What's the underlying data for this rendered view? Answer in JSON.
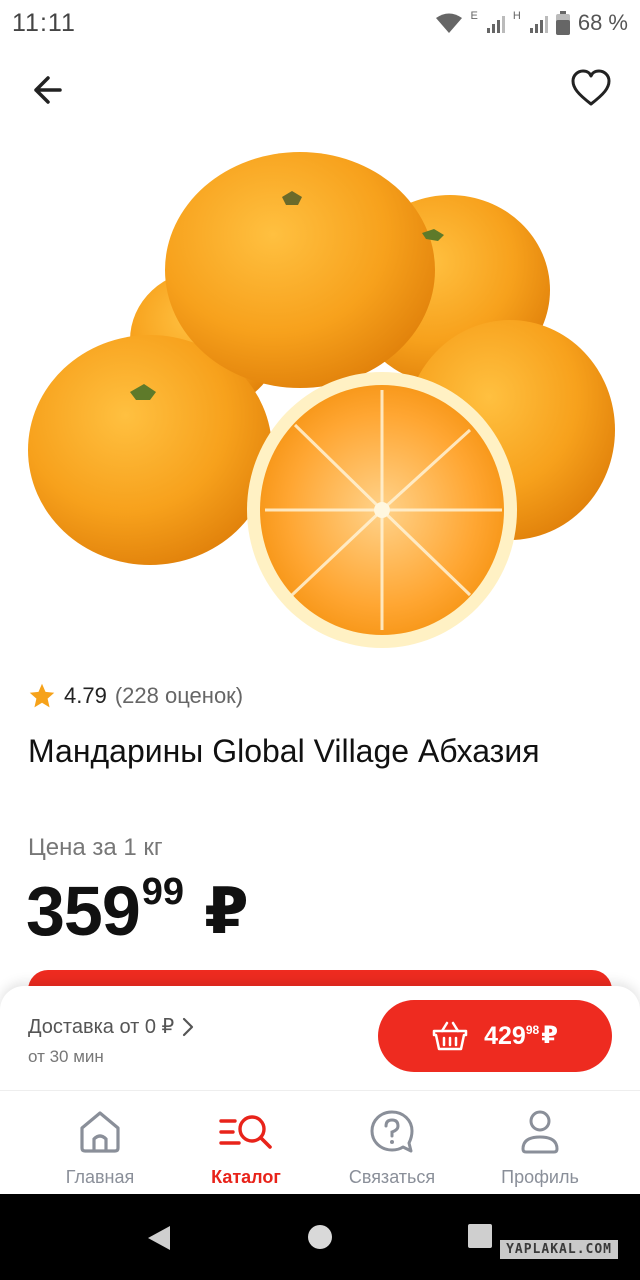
{
  "status_bar": {
    "time": "11:11",
    "network_1": "E",
    "network_2": "H",
    "battery": "68 %"
  },
  "top_nav": {
    "back_icon": "arrow-left-icon",
    "favorite_icon": "heart-outline-icon"
  },
  "product": {
    "image": "mandarins-photo",
    "rating_icon": "star-icon",
    "rating_value": "4.79",
    "rating_count": "(228 оценок)",
    "title": "Мандарины Global Village Абхазия",
    "price_caption": "Цена за 1 кг",
    "price_integer": "359",
    "price_fraction": "99",
    "price_currency": "₽"
  },
  "delivery_bar": {
    "delivery_text": "Доставка от 0 ₽",
    "delivery_time": "от 30 мин",
    "cart_icon": "basket-icon",
    "cart_integer": "429",
    "cart_fraction": "98",
    "cart_currency": "₽"
  },
  "tabs": [
    {
      "label": "Главная",
      "icon": "home-icon",
      "active": false
    },
    {
      "label": "Каталог",
      "icon": "catalog-search-icon",
      "active": true
    },
    {
      "label": "Связаться",
      "icon": "help-chat-icon",
      "active": false
    },
    {
      "label": "Профиль",
      "icon": "profile-icon",
      "active": false
    }
  ],
  "watermark": "YAPLAKAL.COM",
  "colors": {
    "accent_red": "#ee2b20",
    "star": "#f6a21a",
    "orange": "#f7a11c",
    "inactive_tab": "#8a8f99"
  }
}
